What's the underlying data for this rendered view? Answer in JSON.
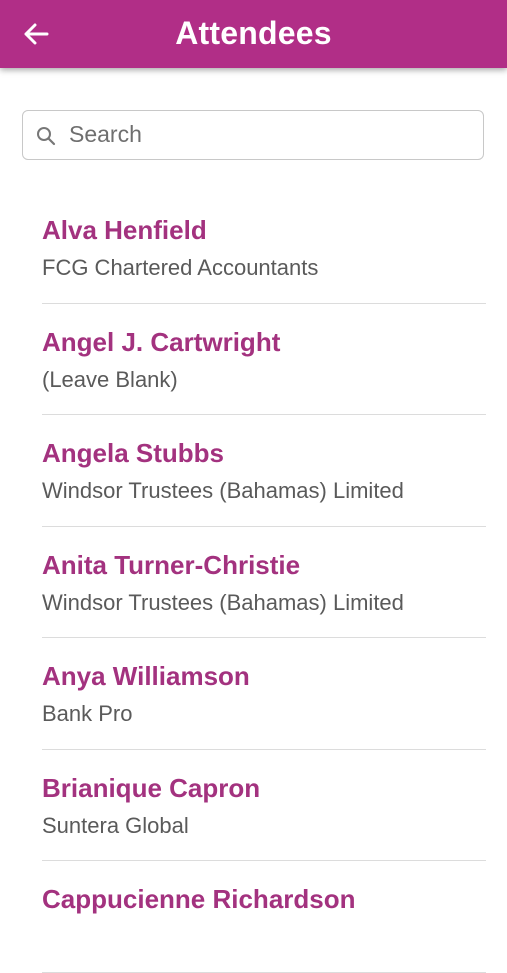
{
  "header": {
    "title": "Attendees",
    "back_icon": "arrow-left-icon"
  },
  "search": {
    "placeholder": "Search",
    "value": "",
    "icon": "search-icon"
  },
  "colors": {
    "app_bar": "#b12e87",
    "name_text": "#a3327f",
    "company_text": "#5a5a5a",
    "divider": "#dcdcdc"
  },
  "attendees": [
    {
      "name": "Alva Henfield",
      "company": "FCG Chartered Accountants"
    },
    {
      "name": "Angel J. Cartwright",
      "company": "(Leave Blank)"
    },
    {
      "name": "Angela Stubbs",
      "company": "Windsor Trustees (Bahamas) Limited"
    },
    {
      "name": "Anita Turner-Christie",
      "company": "Windsor Trustees (Bahamas) Limited"
    },
    {
      "name": "Anya Williamson",
      "company": "Bank Pro"
    },
    {
      "name": "Brianique Capron",
      "company": "Suntera Global"
    },
    {
      "name": "Cappucienne Richardson",
      "company": ""
    }
  ]
}
